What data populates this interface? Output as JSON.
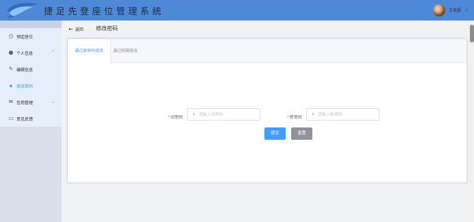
{
  "header": {
    "title": "捷足先登座位管理系统",
    "username": "王浩慧",
    "dropdown_icon": "chevron-down-icon",
    "bar_color": "#4d89d6"
  },
  "sidebar": {
    "items": [
      {
        "label": "预定座位",
        "icon": "clock-icon",
        "active": false
      },
      {
        "label": "个人信息",
        "icon": "user-icon",
        "active": false,
        "expandable": true
      },
      {
        "label": "编辑信息",
        "icon": "edit-icon",
        "active": false
      },
      {
        "label": "修改密码",
        "icon": "lock-icon",
        "active": true
      },
      {
        "label": "信用管理",
        "icon": "mail-icon",
        "active": false,
        "expandable": true
      },
      {
        "label": "意见反馈",
        "icon": "folder-icon",
        "active": false
      }
    ]
  },
  "page": {
    "back_label": "返回",
    "title": "修改密码"
  },
  "tabs": [
    {
      "label": "通过原密码修改",
      "active": true
    },
    {
      "label": "通过邮箱修改",
      "active": false
    }
  ],
  "form": {
    "old_password": {
      "label": "旧密码",
      "placeholder": "请输入旧密码",
      "value": ""
    },
    "new_password": {
      "label": "新密码",
      "placeholder": "请输入新密码",
      "value": ""
    },
    "submit_label": "提交",
    "reset_label": "重置"
  },
  "colors": {
    "accent": "#409eff",
    "reset_button": "#909399",
    "required_mark": "#f56c6c"
  }
}
